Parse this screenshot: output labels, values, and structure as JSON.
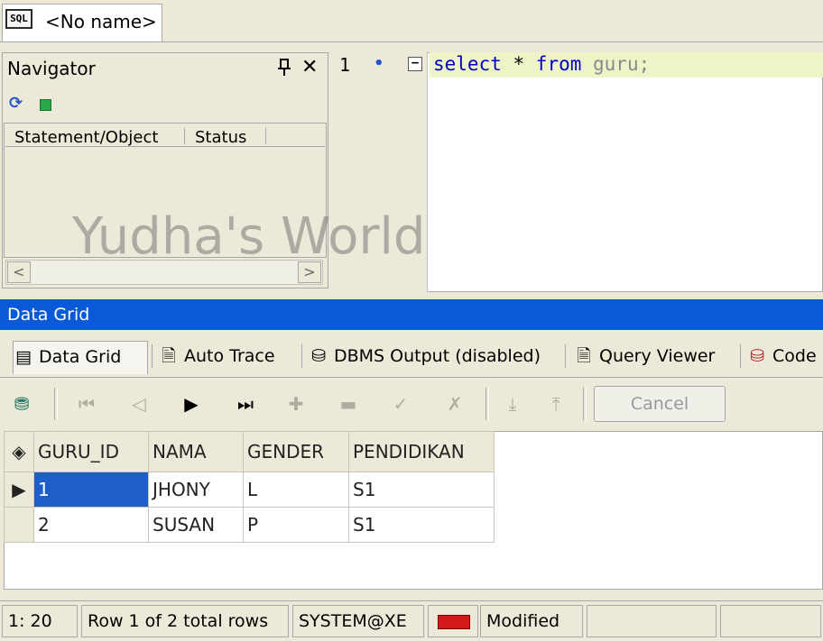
{
  "document_tab": {
    "label": "<No name>",
    "icon": "sql-file-icon",
    "icon_text": "SQL"
  },
  "navigator": {
    "title": "Navigator",
    "columns": [
      "Statement/Object",
      "Status"
    ],
    "watermark": "Yudha's World"
  },
  "editor": {
    "line_number": "1",
    "code": {
      "kw1": "select",
      "star": " * ",
      "kw2": "from",
      "rest": " guru;"
    }
  },
  "data_grid_title": "Data Grid",
  "tabs": [
    {
      "label": "Data Grid",
      "icon": "data-grid-icon"
    },
    {
      "label": "Auto Trace",
      "icon": "auto-trace-icon"
    },
    {
      "label": "DBMS Output (disabled)",
      "icon": "dbms-output-icon"
    },
    {
      "label": "Query Viewer",
      "icon": "query-viewer-icon"
    },
    {
      "label": "Code",
      "icon": "code-icon"
    }
  ],
  "toolbar": {
    "cancel_label": "Cancel"
  },
  "grid": {
    "columns": [
      "GURU_ID",
      "NAMA",
      "GENDER",
      "PENDIDIKAN"
    ],
    "rows": [
      [
        "1",
        "JHONY",
        "L",
        "S1"
      ],
      [
        "2",
        "SUSAN",
        "P",
        "S1"
      ]
    ]
  },
  "status": {
    "position": "1:  20",
    "rows_text": "Row 1 of 2 total rows",
    "connection": "SYSTEM@XE",
    "modified": "Modified"
  },
  "colors": {
    "accent": "#0a5ad8",
    "selection": "#1e5ec8",
    "modified_indicator": "#d21a1a"
  }
}
